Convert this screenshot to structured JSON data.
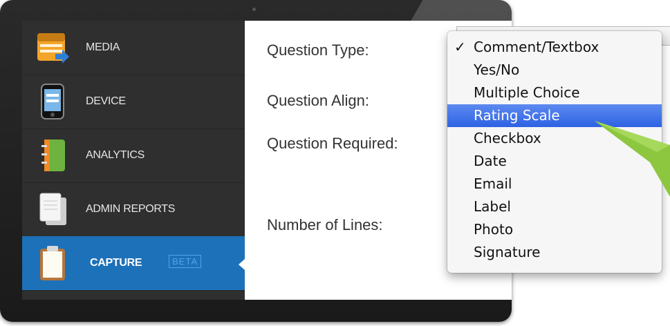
{
  "sidebar": {
    "items": [
      {
        "label": "MEDIA"
      },
      {
        "label": "DEVICE"
      },
      {
        "label": "ANALYTICS"
      },
      {
        "label": "ADMIN REPORTS"
      },
      {
        "label": "CAPTURE",
        "badge": "BETA",
        "active": true
      }
    ]
  },
  "form": {
    "question_type_label": "Question Type:",
    "question_align_label": "Question Align:",
    "question_required_label": "Question Required:",
    "number_of_lines_label": "Number of Lines:"
  },
  "dropdown": {
    "check": "✓",
    "selected": "Comment/Textbox",
    "highlighted": "Rating Scale",
    "options": [
      "Comment/Textbox",
      "Yes/No",
      "Multiple Choice",
      "Rating Scale",
      "Checkbox",
      "Date",
      "Email",
      "Label",
      "Photo",
      "Signature"
    ]
  },
  "colors": {
    "accent": "#1d71b8",
    "highlight": "#3b6fe6",
    "arrow": "#8dc63f"
  }
}
